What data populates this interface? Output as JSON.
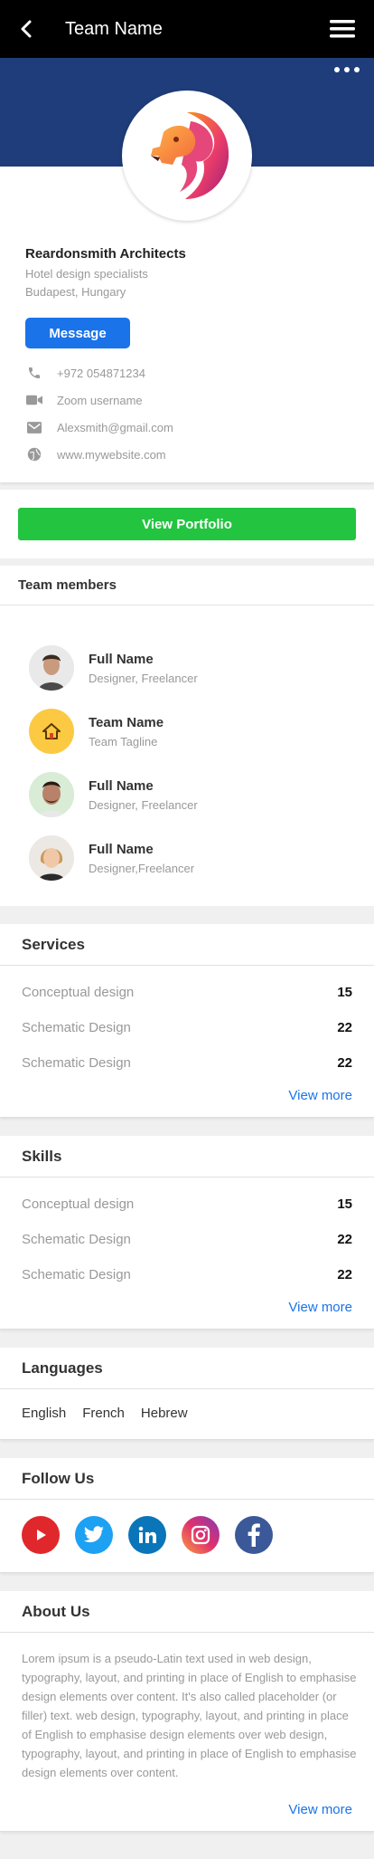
{
  "header": {
    "title": "Team Name",
    "back_icon": "chevron-left-icon",
    "menu_icon": "hamburger-icon",
    "more_icon": "more-dots-icon"
  },
  "profile": {
    "logo_icon": "lion-logo-icon",
    "company": "Reardonsmith Architects",
    "tagline": "Hotel design specialists",
    "location": "Budapest, Hungary",
    "message_label": "Message",
    "contacts": [
      {
        "icon": "phone-icon",
        "text": "+972 054871234"
      },
      {
        "icon": "video-camera-icon",
        "text": "Zoom username"
      },
      {
        "icon": "mail-icon",
        "text": "Alexsmith@gmail.com"
      },
      {
        "icon": "globe-icon",
        "text": "www.mywebsite.com"
      }
    ]
  },
  "portfolio": {
    "label": "View Portfolio"
  },
  "team": {
    "heading": "Team members",
    "members": [
      {
        "name": "Full Name",
        "role": "Designer, Freelancer"
      },
      {
        "name": "Team Name",
        "role": "Team Tagline"
      },
      {
        "name": "Full Name",
        "role": "Designer, Freelancer"
      },
      {
        "name": "Full Name",
        "role": "Designer,Freelancer"
      }
    ]
  },
  "services": {
    "heading": "Services",
    "rows": [
      {
        "label": "Conceptual design",
        "value": "15"
      },
      {
        "label": "Schematic Design",
        "value": "22"
      },
      {
        "label": "Schematic Design",
        "value": "22"
      }
    ],
    "view_more": "View more"
  },
  "skills": {
    "heading": "Skills",
    "rows": [
      {
        "label": "Conceptual design",
        "value": "15"
      },
      {
        "label": "Schematic Design",
        "value": "22"
      },
      {
        "label": "Schematic Design",
        "value": "22"
      }
    ],
    "view_more": "View more"
  },
  "languages": {
    "heading": "Languages",
    "items": [
      "English",
      "French",
      "Hebrew"
    ]
  },
  "follow": {
    "heading": "Follow Us",
    "icons": [
      "youtube-icon",
      "twitter-icon",
      "linkedin-icon",
      "instagram-icon",
      "facebook-icon"
    ],
    "colors": {
      "youtube": "#e0272b",
      "twitter": "#1da1f2",
      "linkedin": "#0a75b8",
      "instagram": "#d6249f",
      "facebook": "#3b5998"
    }
  },
  "about": {
    "heading": "About Us",
    "text": "Lorem ipsum is a pseudo-Latin text used in web design, typography, layout, and printing in place of English to emphasise design elements over content. It's also called placeholder (or filler) text. web design, typography, layout, and printing in place of English to emphasise design elements over web design, typography, layout, and printing in place of English to emphasise design elements over content.",
    "view_more": "View more"
  },
  "colors": {
    "topbar": "#000000",
    "banner": "#1e3d7a",
    "primary": "#1a73e8",
    "success": "#22c440"
  }
}
